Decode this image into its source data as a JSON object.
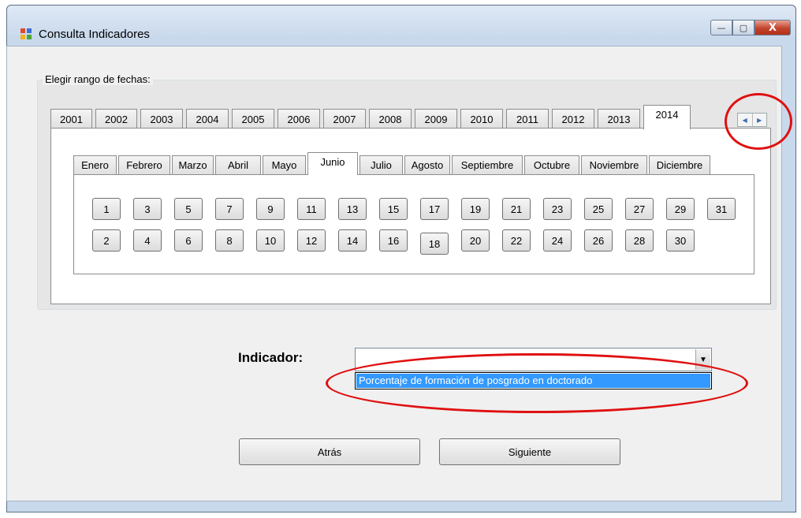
{
  "window": {
    "title": "Consulta Indicadores",
    "controls": {
      "minimize": "—",
      "maximize": "▢",
      "close": "X"
    }
  },
  "date_range": {
    "label": "Elegir rango de fechas:",
    "years": [
      "2001",
      "2002",
      "2003",
      "2004",
      "2005",
      "2006",
      "2007",
      "2008",
      "2009",
      "2010",
      "2011",
      "2012",
      "2013",
      "2014"
    ],
    "selected_year": "2014",
    "scroll_left": "◀",
    "scroll_right": "▶",
    "months": [
      "Enero",
      "Febrero",
      "Marzo",
      "Abril",
      "Mayo",
      "Junio",
      "Julio",
      "Agosto",
      "Septiembre",
      "Octubre",
      "Noviembre",
      "Diciembre"
    ],
    "selected_month": "Junio",
    "days_row1": [
      "1",
      "3",
      "5",
      "7",
      "9",
      "11",
      "13",
      "15",
      "17",
      "19",
      "21",
      "23",
      "25",
      "27",
      "29",
      "31"
    ],
    "days_row2": [
      "2",
      "4",
      "6",
      "8",
      "10",
      "12",
      "14",
      "16",
      "18",
      "20",
      "22",
      "24",
      "26",
      "28",
      "30"
    ]
  },
  "indicator": {
    "label": "Indicador:",
    "value": "",
    "options": [
      "Porcentaje de formación de posgrado en doctorado"
    ],
    "highlighted_option": "Porcentaje de formación de posgrado en doctorado"
  },
  "buttons": {
    "back": "Atrás",
    "next": "Siguiente"
  },
  "colors": {
    "annotation": "#e01010",
    "selection": "#3399ff"
  }
}
